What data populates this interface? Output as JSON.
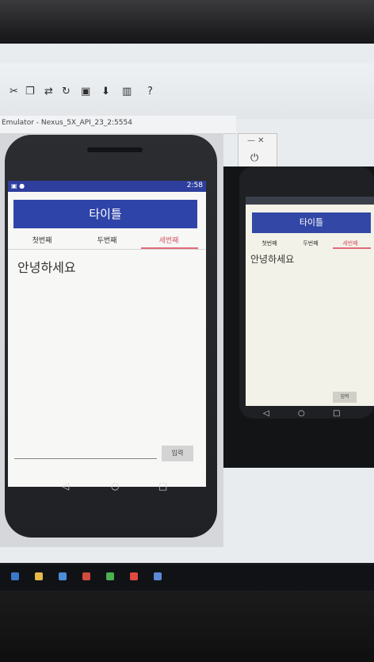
{
  "emulator": {
    "window_title": "Emulator - Nexus_5X_API_23_2:5554"
  },
  "phone1": {
    "status_time": "2:58",
    "title_button": "타이틀",
    "tabs": [
      "첫번째",
      "두번째",
      "세번째"
    ],
    "content_text": "안녕하세요",
    "send_button": "입력"
  },
  "phone2": {
    "title_button": "타이틀",
    "tabs": [
      "첫번째",
      "두번째",
      "세번째"
    ],
    "content_text": "안녕하세요",
    "send_button": "입력"
  },
  "colors": {
    "app_bar": "#2f44a8",
    "active_tab": "#e26a7a",
    "status_bar": "#2f3f9e"
  }
}
